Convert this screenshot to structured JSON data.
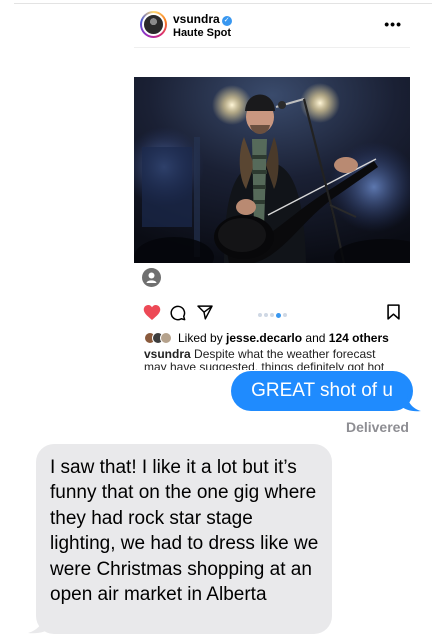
{
  "post": {
    "username": "vsundra",
    "location": "Haute Spot",
    "liked_by_prefix": "Liked by ",
    "liked_by_user": "jesse.decarlo",
    "liked_by_mid": " and ",
    "liked_by_count": "124 others",
    "caption_user": "vsundra",
    "caption_text": " Despite what the weather forecast may have suggested, things definitely got hot",
    "carousel_dots": 5,
    "carousel_active_index": 3
  },
  "messages": {
    "sent_text": "GREAT shot of u",
    "delivered_label": "Delivered",
    "received_text": "I saw that! I like it a lot but it’s funny that on the one gig where they had rock star stage lighting, we had to dress like we were Christmas shopping at an open air market in Alberta"
  },
  "colors": {
    "imessage_blue": "#1f8bfe",
    "received_gray": "#e9e9eb",
    "like_red": "#ed4956",
    "verified_blue": "#3897f0",
    "delivered_gray": "#8e8e93"
  },
  "icons": {
    "more": "ellipsis-icon",
    "like": "heart-icon",
    "comment": "comment-icon",
    "share": "paper-plane-icon",
    "save": "bookmark-icon",
    "tag": "user-tag-icon",
    "verified": "verified-badge-icon"
  }
}
